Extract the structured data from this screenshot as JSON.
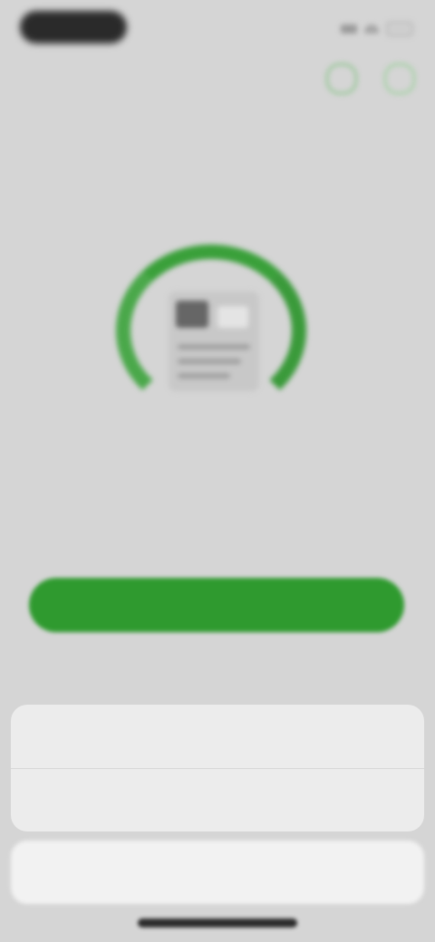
{
  "status_bar": {
    "time": ""
  },
  "nav": {
    "title": "",
    "help_icon": "help-icon",
    "close_icon": "close-icon"
  },
  "content": {
    "heading": "",
    "description": "",
    "primary_button_label": ""
  },
  "sheet": {
    "options": [
      "",
      ""
    ],
    "cancel_label": ""
  },
  "colors": {
    "accent": "#2f9a2f",
    "accent_light": "#5fbf5f",
    "background": "#d5d5d5",
    "sheet_bg": "#ececec"
  }
}
